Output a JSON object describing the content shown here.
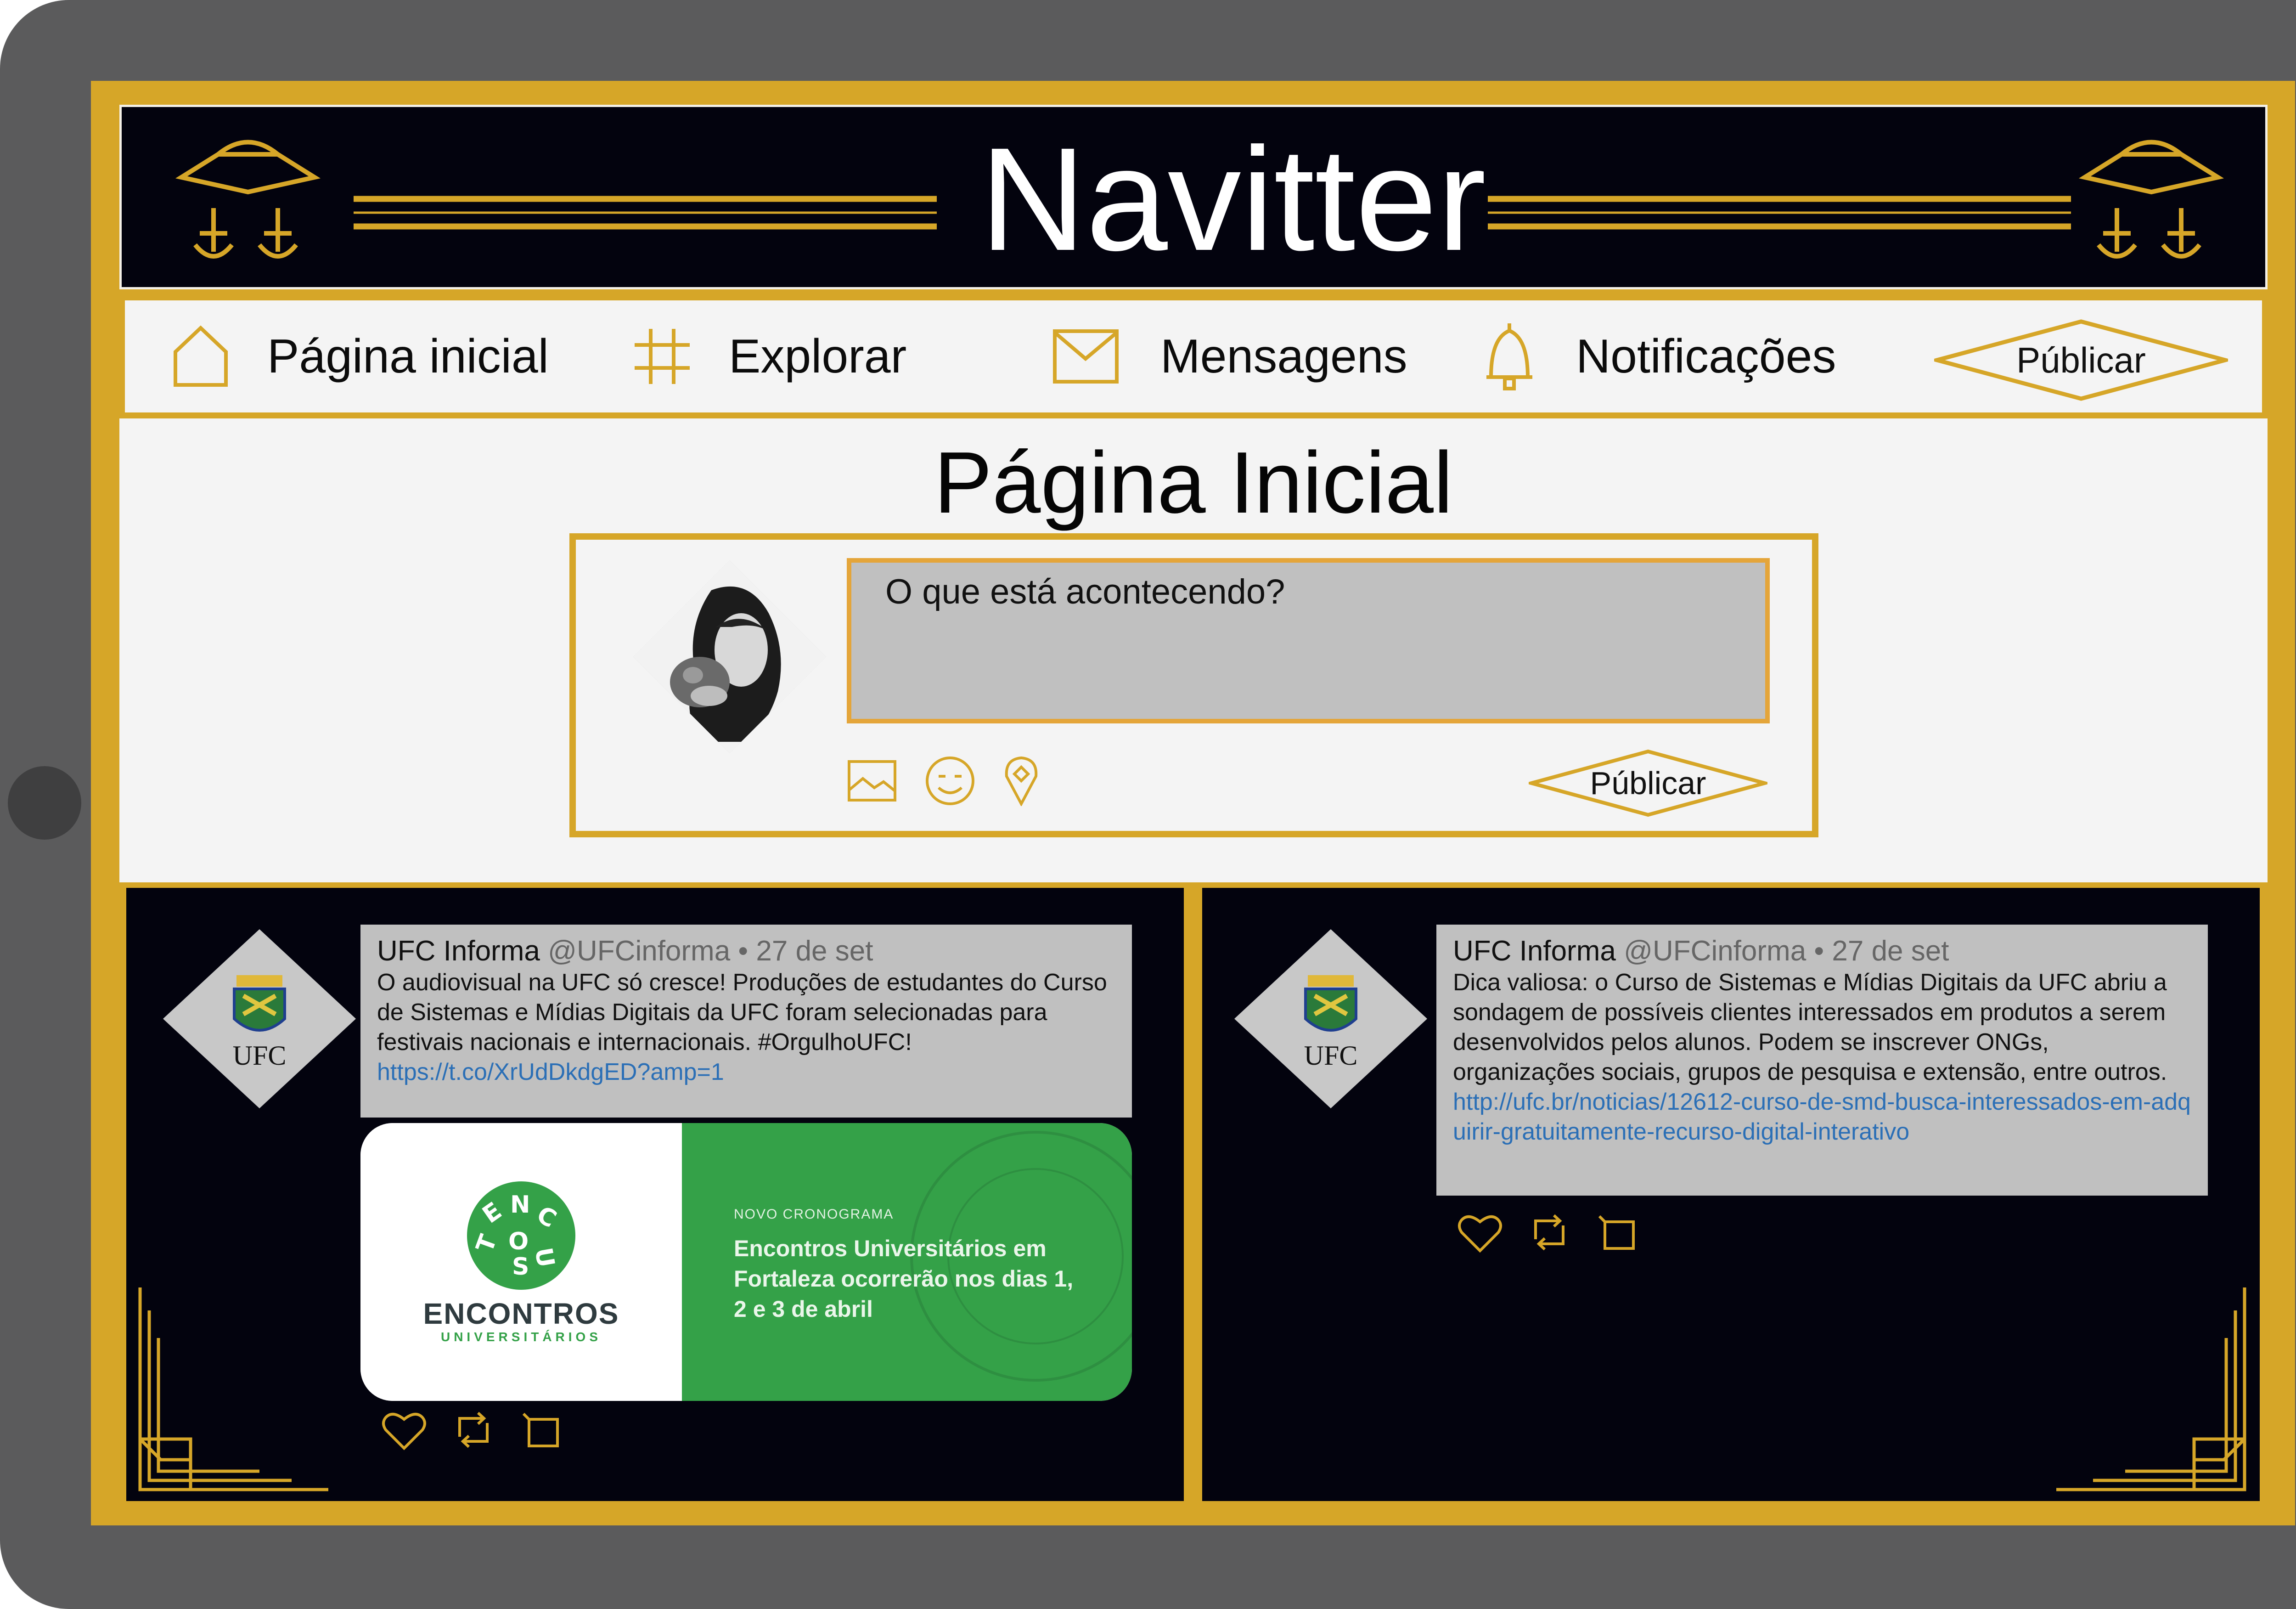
{
  "app": {
    "title": "Navitter"
  },
  "nav": {
    "items": [
      {
        "label": "Página inicial",
        "icon": "home-icon"
      },
      {
        "label": "Explorar",
        "icon": "hashtag-icon"
      },
      {
        "label": "Mensagens",
        "icon": "envelope-icon"
      },
      {
        "label": "Notificações",
        "icon": "bell-icon"
      }
    ],
    "publish_label": "Públicar"
  },
  "main": {
    "title": "Página Inicial",
    "composer": {
      "placeholder": "O que está acontecendo?",
      "publish_label": "Públicar",
      "tools": [
        "image-icon",
        "emoji-icon",
        "location-icon"
      ]
    }
  },
  "feed": [
    {
      "avatar_text": "UFC",
      "name": "UFC Informa",
      "handle": "@UFCinforma",
      "separator": "•",
      "date": "27 de set",
      "text": "O audiovisual na UFC só cresce! Produções de estudantes do Curso de Sistemas e Mídias Digitais da UFC foram selecionadas para festivais nacionais e internacionais. #OrgulhoUFC!",
      "link": "https://t.co/XrUdDkdgED?amp=1",
      "media": {
        "brand": "ENCONTROS",
        "brand_sub": "UNIVERSITÁRIOS",
        "kicker": "NOVO CRONOGRAMA",
        "headline": "Encontros Universitários em Fortaleza ocorrerão nos dias 1, 2 e 3 de abril"
      },
      "actions": [
        "heart-icon",
        "retweet-icon",
        "share-icon"
      ]
    },
    {
      "avatar_text": "UFC",
      "name": "UFC Informa",
      "handle": "@UFCinforma",
      "separator": "•",
      "date": "27 de set",
      "text": "Dica valiosa: o Curso de Sistemas e Mídias Digitais da UFC abriu a sondagem de possíveis clientes interessados em produtos a serem desenvolvidos pelos alunos. Podem se inscrever ONGs, organizações sociais, grupos de pesquisa e extensão, entre outros.",
      "link": "http://ufc.br/noticias/12612-curso-de-smd-busca-interessados-em-adquirir-gratuitamente-recurso-digital-interativo",
      "actions": [
        "heart-icon",
        "retweet-icon",
        "share-icon"
      ]
    }
  ],
  "colors": {
    "gold": "#d6a628",
    "dark": "#03030e",
    "panel": "#f4f4f4",
    "tweet_bg": "#c0c0c0",
    "link": "#2b6fb6",
    "green": "#34a148",
    "bezel": "#5b5b5c"
  }
}
